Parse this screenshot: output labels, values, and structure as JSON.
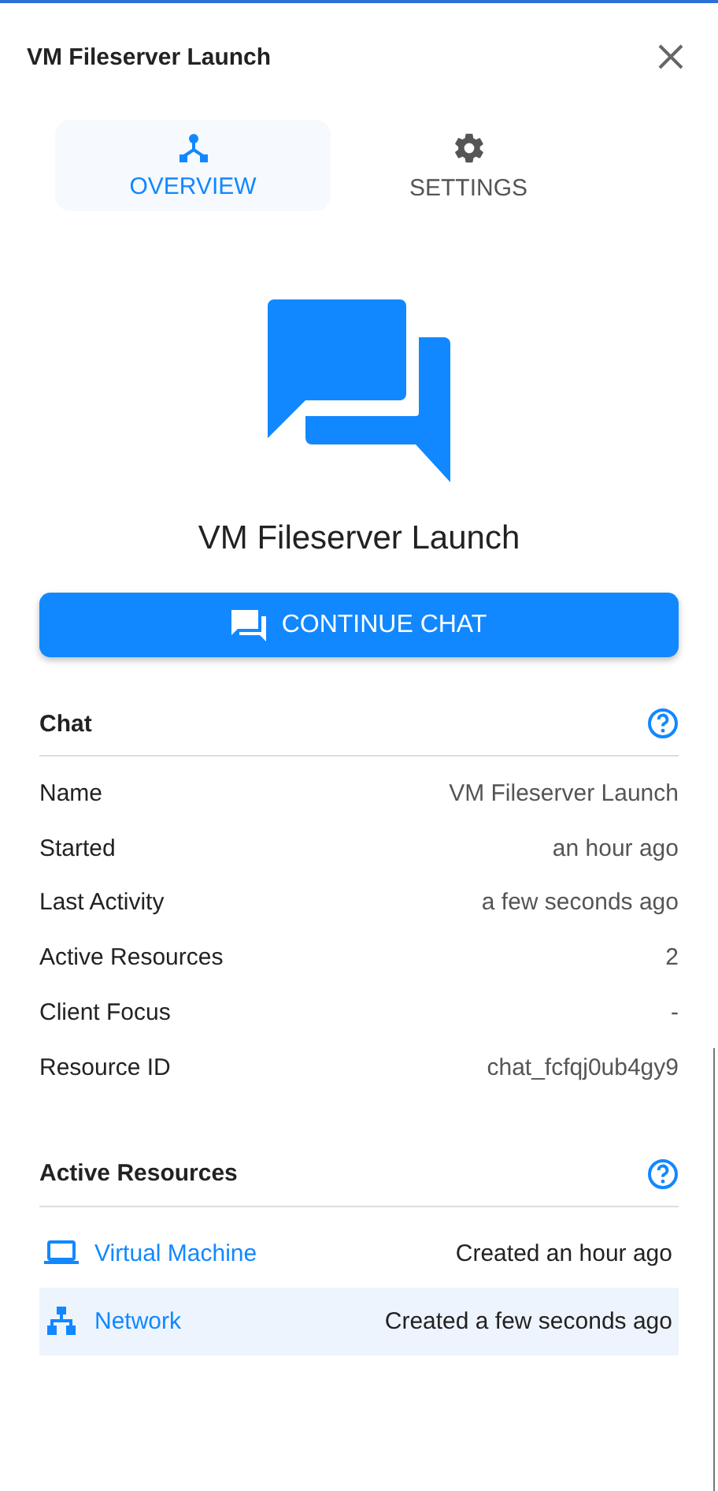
{
  "panel": {
    "title": "VM Fileserver Launch"
  },
  "tabs": [
    {
      "label": "OVERVIEW",
      "kind": "overview",
      "selected": true
    },
    {
      "label": "SETTINGS",
      "kind": "settings",
      "selected": false
    }
  ],
  "hero": {
    "title": "VM Fileserver Launch",
    "button": "CONTINUE CHAT"
  },
  "chat": {
    "heading": "Chat",
    "rows": [
      {
        "label": "Name",
        "value": "VM Fileserver Launch"
      },
      {
        "label": "Started",
        "value": "an hour ago"
      },
      {
        "label": "Last Activity",
        "value": "a few seconds ago"
      },
      {
        "label": "Active Resources",
        "value": "2"
      },
      {
        "label": "Client Focus",
        "value": "-"
      },
      {
        "label": "Resource ID",
        "value": "chat_fcfqj0ub4gy9"
      }
    ]
  },
  "resources": {
    "heading": "Active Resources",
    "items": [
      {
        "kind": "vm",
        "name": "Virtual Machine",
        "created": "Created an hour ago",
        "selected": false
      },
      {
        "kind": "network",
        "name": "Network",
        "created": "Created a few seconds ago",
        "selected": true
      }
    ]
  }
}
